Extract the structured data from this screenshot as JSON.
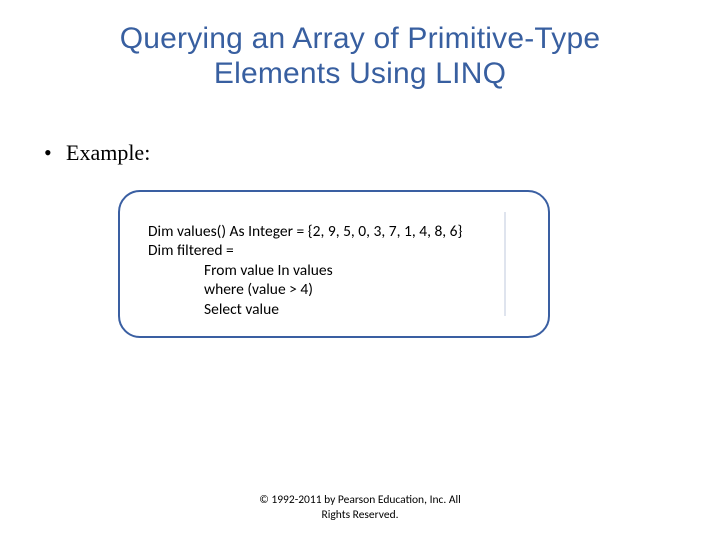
{
  "title_line1": "Querying an Array of Primitive-Type",
  "title_line2": "Elements Using LINQ",
  "bullet": {
    "marker": "•",
    "text": "Example:"
  },
  "code": {
    "l1": "Dim values() As Integer = {2, 9, 5, 0, 3, 7, 1, 4, 8, 6}",
    "l2": "Dim filtered =",
    "l3": "From  value In values",
    "l4": "where (value > 4)",
    "l5": "Select value"
  },
  "footer": {
    "line1": "© 1992-2011 by Pearson Education, Inc. All",
    "line2": "Rights Reserved."
  }
}
